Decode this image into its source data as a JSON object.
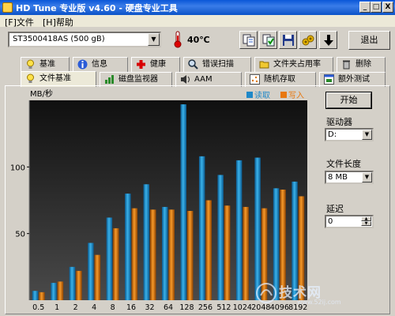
{
  "window": {
    "title": "HD Tune 专业版 v4.60 - 硬盘专业工具",
    "buttons": [
      "_",
      "□",
      "X"
    ]
  },
  "menu": [
    "[F]文件",
    "[H]帮助"
  ],
  "toolbar": {
    "drive": "ST3500418AS (500 gB)",
    "temperature": "40℃",
    "exit_label": "退出"
  },
  "tabs_row1": [
    "基准",
    "信息",
    "健康",
    "错误扫描",
    "文件夹占用率",
    "删除"
  ],
  "tabs_row2": [
    "文件基准",
    "磁盘监视器",
    "AAM",
    "随机存取",
    "额外测试"
  ],
  "active_tab": "文件基准",
  "side_panel": {
    "start_label": "开始",
    "drive_label": "驱动器",
    "drive_value": "D:",
    "file_length_label": "文件长度",
    "file_length_value": "8 MB",
    "delay_label": "延迟",
    "delay_value": "0"
  },
  "chart_data": {
    "type": "bar",
    "ylabel": "MB/秒",
    "categories": [
      "0.5",
      "1",
      "2",
      "4",
      "8",
      "16",
      "32",
      "64",
      "128",
      "256",
      "512",
      "1024",
      "2048",
      "4096",
      "8192"
    ],
    "ylim": [
      0,
      150
    ],
    "yticks": [
      50,
      100
    ],
    "grid": false,
    "legend_position": "top-right",
    "series": [
      {
        "name": "读取",
        "color": "#1e88c8",
        "values": [
          7,
          13,
          25,
          43,
          62,
          80,
          87,
          70,
          147,
          108,
          94,
          105,
          107,
          84,
          89
        ]
      },
      {
        "name": "写入",
        "color": "#e87810",
        "values": [
          6,
          14,
          22,
          34,
          54,
          69,
          68,
          68,
          67,
          75,
          71,
          70,
          69,
          83,
          78
        ]
      }
    ]
  },
  "watermark": {
    "text": "技术网",
    "sub": "www.52ij.com"
  }
}
